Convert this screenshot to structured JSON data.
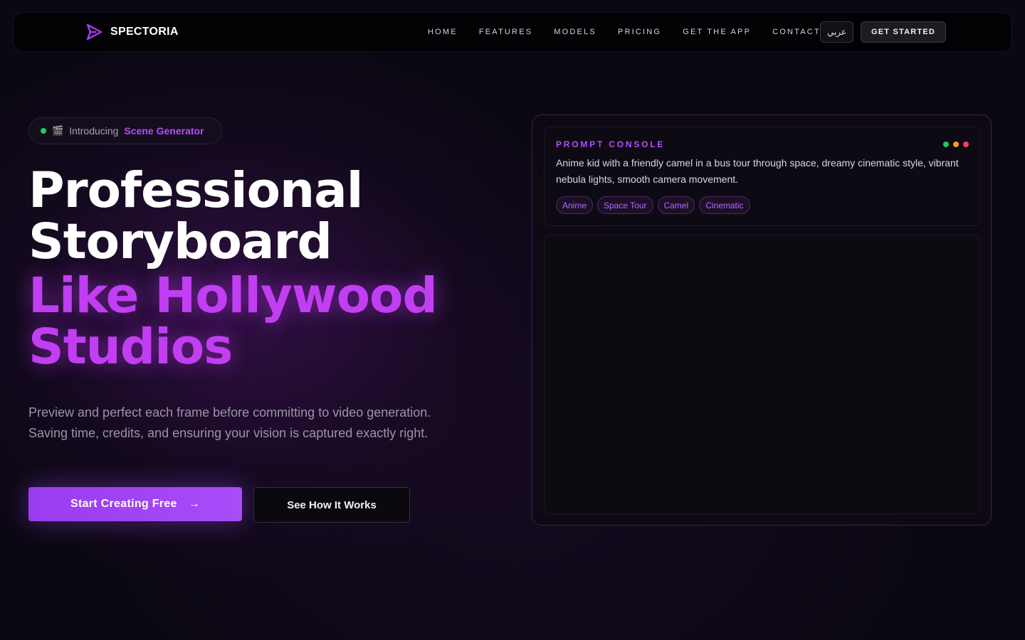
{
  "nav": {
    "brand": "SPECTORIA",
    "links": [
      "HOME",
      "FEATURES",
      "MODELS",
      "PRICING",
      "GET THE APP",
      "CONTACT"
    ],
    "lang_label": "عربي",
    "cta_label": "GET STARTED"
  },
  "hero": {
    "badge": {
      "icon": "clapperboard-icon",
      "intro": "Introducing",
      "highlight": "Scene Generator"
    },
    "headline_white": [
      "Professional",
      "Storyboard"
    ],
    "headline_purple": [
      "Like Hollywood",
      "Studios"
    ],
    "subtitle": "Preview and perfect each frame before committing to video generation. Saving time, credits, and ensuring your vision is captured exactly right.",
    "primary_cta": "Start Creating Free",
    "secondary_cta": "See How It Works"
  },
  "console": {
    "title": "PROMPT CONSOLE",
    "prompt": "Anime kid with a friendly camel in a bus tour through space, dreamy cinematic style, vibrant nebula lights, smooth camera movement.",
    "tags": [
      "Anime",
      "Space Tour",
      "Camel",
      "Cinematic"
    ],
    "dot_colors": [
      "#22c55e",
      "#f59e0b",
      "#f43f5e"
    ]
  },
  "colors": {
    "accent": "#b44dff",
    "headline_purple": "#c13ef2",
    "background": "#0b0812"
  }
}
